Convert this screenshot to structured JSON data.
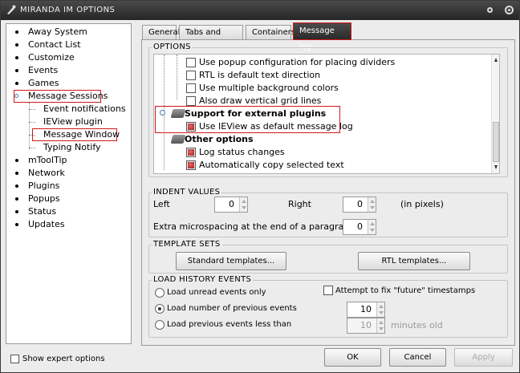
{
  "window": {
    "title": "MIRANDA IM OPTIONS"
  },
  "tree": {
    "items": [
      {
        "label": "Away System",
        "level": 0
      },
      {
        "label": "Contact List",
        "level": 0
      },
      {
        "label": "Customize",
        "level": 0
      },
      {
        "label": "Events",
        "level": 0
      },
      {
        "label": "Games",
        "level": 0
      },
      {
        "label": "Message Sessions",
        "level": 0,
        "expanded": true,
        "highlighted": true
      },
      {
        "label": "Event notifications",
        "level": 1
      },
      {
        "label": "IEView plugin",
        "level": 1
      },
      {
        "label": "Message Window",
        "level": 1,
        "selected": true,
        "highlighted": true
      },
      {
        "label": "Typing Notify",
        "level": 1
      },
      {
        "label": "mToolTip",
        "level": 0
      },
      {
        "label": "Network",
        "level": 0
      },
      {
        "label": "Plugins",
        "level": 0
      },
      {
        "label": "Popups",
        "level": 0
      },
      {
        "label": "Status",
        "level": 0
      },
      {
        "label": "Updates",
        "level": 0
      }
    ]
  },
  "tabs": [
    "General",
    "Tabs and layout",
    "Containers",
    "Message log"
  ],
  "active_tab": "Message log",
  "options": {
    "title": "OPTIONS",
    "rows": [
      {
        "type": "check",
        "label": "Use popup configuration for placing dividers",
        "checked": false
      },
      {
        "type": "check",
        "label": "RTL is default text direction",
        "checked": false
      },
      {
        "type": "check",
        "label": "Use multiple background colors",
        "checked": false
      },
      {
        "type": "check",
        "label": "Also draw vertical grid lines",
        "checked": false
      },
      {
        "type": "group",
        "label": "Support for external plugins"
      },
      {
        "type": "check",
        "label": "Use IEView as default message log",
        "checked": true
      },
      {
        "type": "group",
        "label": "Other options"
      },
      {
        "type": "check",
        "label": "Log status changes",
        "checked": true
      },
      {
        "type": "check",
        "label": "Automatically copy selected text",
        "checked": true
      }
    ]
  },
  "indent": {
    "title": "INDENT VALUES",
    "left_label": "Left",
    "left_value": "0",
    "right_label": "Right",
    "right_value": "0",
    "unit": "(in pixels)",
    "micro_label": "Extra microspacing at the end of a paragraph",
    "micro_value": "0"
  },
  "templates": {
    "title": "TEMPLATE SETS",
    "standard": "Standard templates...",
    "rtl": "RTL templates..."
  },
  "history": {
    "title": "LOAD HISTORY EVENTS",
    "opt_unread": "Load unread events only",
    "opt_number": "Load number of previous events",
    "opt_less": "Load previous events less than",
    "fix_future": "Attempt to fix \"future\" timestamps",
    "number_value": "10",
    "minutes_value": "10",
    "minutes_unit": "minutes old",
    "selected": "number"
  },
  "footer": {
    "expert": "Show expert options",
    "ok": "OK",
    "cancel": "Cancel",
    "apply": "Apply"
  }
}
